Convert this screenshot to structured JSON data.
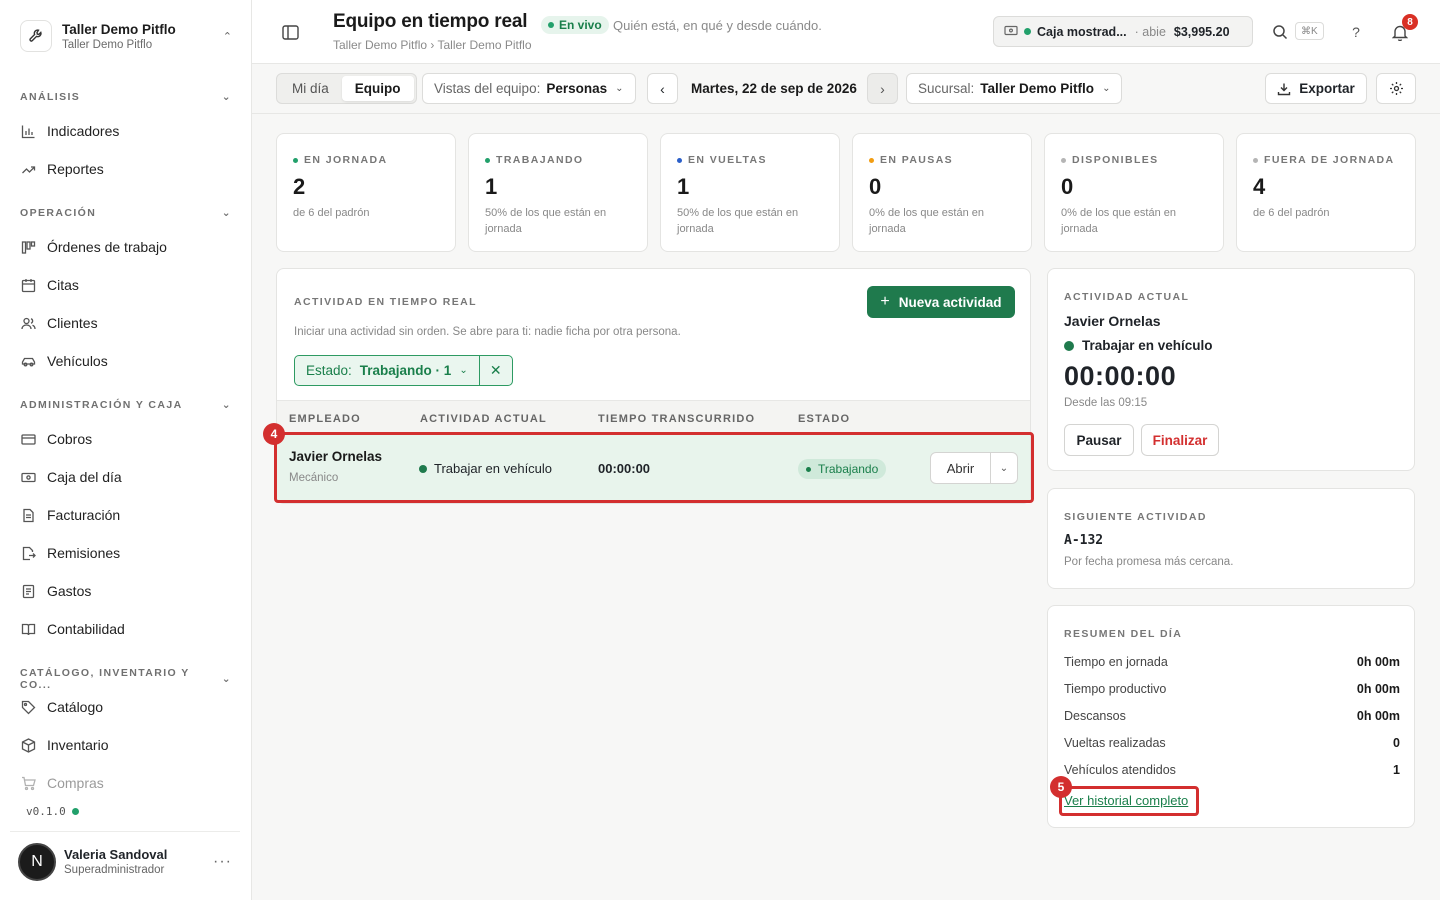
{
  "workspace": {
    "name": "Taller Demo Pitflo",
    "sub": "Taller Demo Pitflo"
  },
  "sidebar": {
    "sections": [
      {
        "label": "ANÁLISIS"
      },
      {
        "label": "OPERACIÓN"
      },
      {
        "label": "ADMINISTRACIÓN Y CAJA"
      },
      {
        "label": "CATÁLOGO, INVENTARIO Y CO..."
      }
    ],
    "items": [
      {
        "label": "Indicadores",
        "icon": "bar-chart-icon"
      },
      {
        "label": "Reportes",
        "icon": "trend-icon"
      },
      {
        "label": "Órdenes de trabajo",
        "icon": "kanban-icon"
      },
      {
        "label": "Citas",
        "icon": "calendar-icon"
      },
      {
        "label": "Clientes",
        "icon": "users-icon"
      },
      {
        "label": "Vehículos",
        "icon": "car-icon"
      },
      {
        "label": "Cobros",
        "icon": "card-icon"
      },
      {
        "label": "Caja del día",
        "icon": "cash-icon"
      },
      {
        "label": "Facturación",
        "icon": "invoice-icon"
      },
      {
        "label": "Remisiones",
        "icon": "file-export-icon"
      },
      {
        "label": "Gastos",
        "icon": "receipt-icon"
      },
      {
        "label": "Contabilidad",
        "icon": "book-icon"
      },
      {
        "label": "Catálogo",
        "icon": "tag-icon"
      },
      {
        "label": "Inventario",
        "icon": "box-icon"
      },
      {
        "label": "Compras",
        "icon": "cart-icon"
      }
    ],
    "version": "v0.1.0"
  },
  "user": {
    "initial": "N",
    "name": "Valeria Sandoval",
    "role": "Superadministrador",
    "more": "···"
  },
  "header": {
    "title": "Equipo en tiempo real",
    "live": "En vivo",
    "subtitle": "Quién está, en qué y desde cuándo.",
    "breadcrumb": "Taller Demo Pitflo › Taller Demo Pitflo",
    "caja_name": "Caja mostrad...",
    "caja_state": "· abie",
    "caja_amount": "$3,995.20",
    "shortcut": "⌘K",
    "help": "?",
    "notifications": "8"
  },
  "toolbar": {
    "view_tabs": [
      "Mi día",
      "Equipo"
    ],
    "team_view_label": "Vistas del equipo:",
    "team_view_value": "Personas",
    "prev": "‹",
    "date": "Martes, 22 de sep de 2026",
    "next": "›",
    "branch_label": "Sucursal:",
    "branch_value": "Taller Demo Pitflo",
    "export": "Exportar"
  },
  "stats": [
    {
      "label": "EN JORNADA",
      "value": "2",
      "desc": "de 6 del padrón",
      "color": "#22a06b"
    },
    {
      "label": "TRABAJANDO",
      "value": "1",
      "desc": "50% de los que están en jornada",
      "color": "#22a06b"
    },
    {
      "label": "EN VUELTAS",
      "value": "1",
      "desc": "50% de los que están en jornada",
      "color": "#2b5fc9"
    },
    {
      "label": "EN PAUSAS",
      "value": "0",
      "desc": "0% de los que están en jornada",
      "color": "#f29d12"
    },
    {
      "label": "DISPONIBLES",
      "value": "0",
      "desc": "0% de los que están en jornada",
      "color": "#b5b5b5"
    },
    {
      "label": "FUERA DE JORNADA",
      "value": "4",
      "desc": "de 6 del padrón",
      "color": "#b5b5b5"
    }
  ],
  "activity": {
    "title": "ACTIVIDAD EN TIEMPO REAL",
    "new_button": "Nueva actividad",
    "description": "Iniciar una actividad sin orden. Se abre para ti: nadie ficha por otra persona.",
    "filter_label": "Estado:",
    "filter_value": "Trabajando · 1",
    "filter_clear": "✕",
    "columns": [
      "EMPLEADO",
      "ACTIVIDAD ACTUAL",
      "TIEMPO TRANSCURRIDO",
      "ESTADO"
    ],
    "rows": [
      {
        "name": "Javier Ornelas",
        "role": "Mecánico",
        "activity": "Trabajar en vehículo",
        "elapsed": "00:00:00",
        "status": "Trabajando",
        "open": "Abrir"
      }
    ]
  },
  "current": {
    "label": "ACTIVIDAD ACTUAL",
    "employee": "Javier Ornelas",
    "activity": "Trabajar en vehículo",
    "clock": "00:00:00",
    "since": "Desde las 09:15",
    "pause": "Pausar",
    "finish": "Finalizar"
  },
  "next_activity": {
    "label": "SIGUIENTE ACTIVIDAD",
    "order": "A-132",
    "note": "Por fecha promesa más cercana."
  },
  "summary": {
    "label": "RESUMEN DEL DÍA",
    "rows": [
      {
        "label": "Tiempo en jornada",
        "value": "0h 00m"
      },
      {
        "label": "Tiempo productivo",
        "value": "0h 00m"
      },
      {
        "label": "Descansos",
        "value": "0h 00m"
      },
      {
        "label": "Vueltas realizadas",
        "value": "0"
      },
      {
        "label": "Vehículos atendidos",
        "value": "1"
      }
    ],
    "history_link": "Ver historial completo"
  },
  "markers": [
    "4",
    "5"
  ]
}
